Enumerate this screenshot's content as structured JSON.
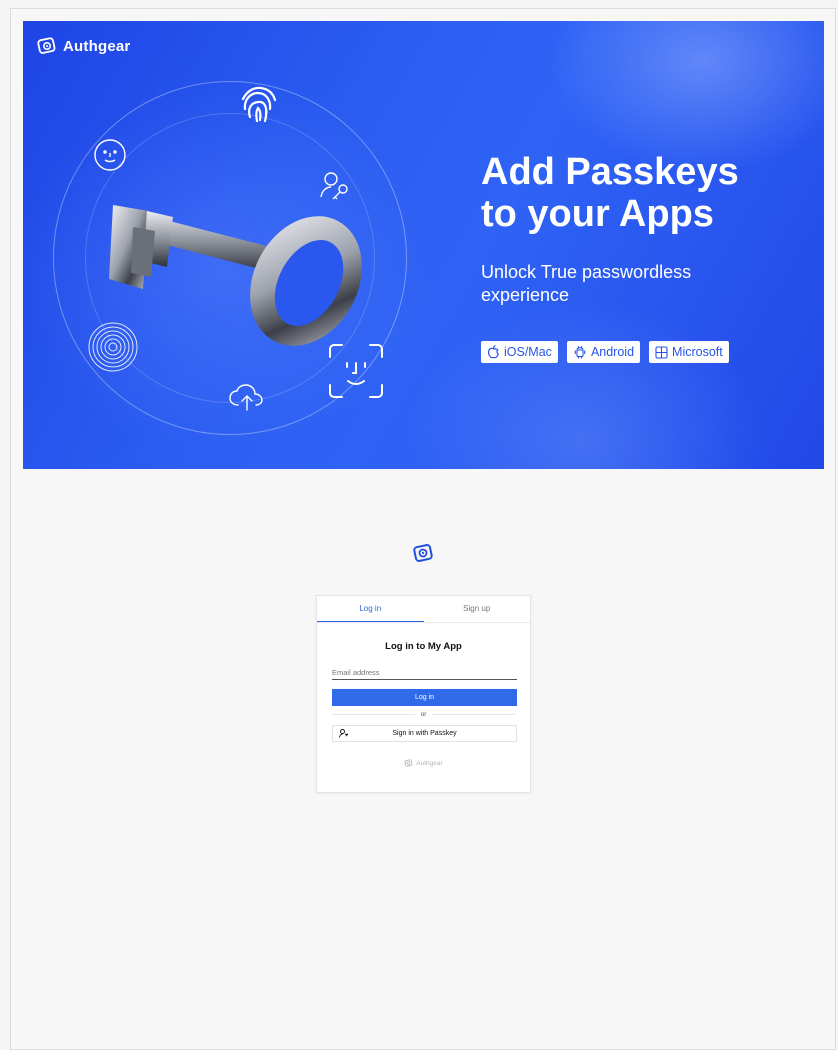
{
  "banner": {
    "brand_name": "Authgear",
    "title_line1": "Add Passkeys",
    "title_line2": "to your Apps",
    "subtitle_line1": "Unlock True passwordless",
    "subtitle_line2": "experience",
    "platforms": [
      {
        "label": "iOS/Mac",
        "icon": "apple-icon"
      },
      {
        "label": "Android",
        "icon": "android-icon"
      },
      {
        "label": "Microsoft",
        "icon": "windows-icon"
      }
    ],
    "colors": {
      "background": "#2a5cf0",
      "badge_text": "#2554ea"
    }
  },
  "login": {
    "tabs": [
      {
        "label": "Log in",
        "active": true
      },
      {
        "label": "Sign up",
        "active": false
      }
    ],
    "title": "Log in to My App",
    "email_placeholder": "Email address",
    "login_button": "Log in",
    "divider_text": "or",
    "passkey_button": "Sign in with Passkey",
    "footer_brand": "Authgear",
    "colors": {
      "accent": "#2f6ae8"
    }
  }
}
